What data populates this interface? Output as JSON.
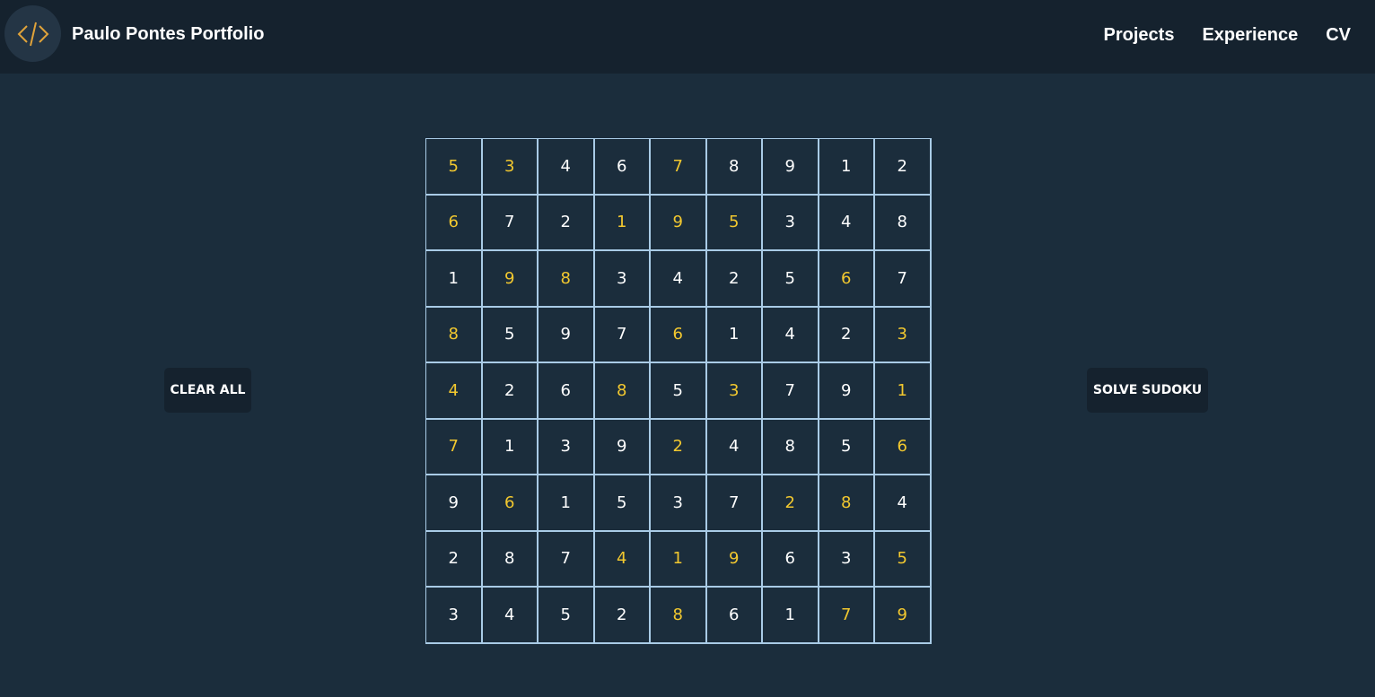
{
  "navbar": {
    "brand": "Paulo Pontes Portfolio",
    "logo_icon": "code-brackets-icon",
    "links": [
      {
        "label": "Projects"
      },
      {
        "label": "Experience"
      },
      {
        "label": "CV"
      }
    ]
  },
  "buttons": {
    "clear_label": "CLEAR ALL",
    "solve_label": "SOLVE SUDOKU"
  },
  "colors": {
    "background": "#1b2d3c",
    "navbar": "#15222e",
    "grid_line": "#a9cbe6",
    "given_digit": "#f2c82f",
    "solved_digit": "#ffffff",
    "logo_accent": "#e0a33a"
  },
  "sudoku": {
    "rows": [
      [
        "5",
        "3",
        "4",
        "6",
        "7",
        "8",
        "9",
        "1",
        "2"
      ],
      [
        "6",
        "7",
        "2",
        "1",
        "9",
        "5",
        "3",
        "4",
        "8"
      ],
      [
        "1",
        "9",
        "8",
        "3",
        "4",
        "2",
        "5",
        "6",
        "7"
      ],
      [
        "8",
        "5",
        "9",
        "7",
        "6",
        "1",
        "4",
        "2",
        "3"
      ],
      [
        "4",
        "2",
        "6",
        "8",
        "5",
        "3",
        "7",
        "9",
        "1"
      ],
      [
        "7",
        "1",
        "3",
        "9",
        "2",
        "4",
        "8",
        "5",
        "6"
      ],
      [
        "9",
        "6",
        "1",
        "5",
        "3",
        "7",
        "2",
        "8",
        "4"
      ],
      [
        "2",
        "8",
        "7",
        "4",
        "1",
        "9",
        "6",
        "3",
        "5"
      ],
      [
        "3",
        "4",
        "5",
        "2",
        "8",
        "6",
        "1",
        "7",
        "9"
      ]
    ],
    "given": [
      [
        1,
        1,
        0,
        0,
        1,
        0,
        0,
        0,
        0
      ],
      [
        1,
        0,
        0,
        1,
        1,
        1,
        0,
        0,
        0
      ],
      [
        0,
        1,
        1,
        0,
        0,
        0,
        0,
        1,
        0
      ],
      [
        1,
        0,
        0,
        0,
        1,
        0,
        0,
        0,
        1
      ],
      [
        1,
        0,
        0,
        1,
        0,
        1,
        0,
        0,
        1
      ],
      [
        1,
        0,
        0,
        0,
        1,
        0,
        0,
        0,
        1
      ],
      [
        0,
        1,
        0,
        0,
        0,
        0,
        1,
        1,
        0
      ],
      [
        0,
        0,
        0,
        1,
        1,
        1,
        0,
        0,
        1
      ],
      [
        0,
        0,
        0,
        0,
        1,
        0,
        0,
        1,
        1
      ]
    ]
  }
}
